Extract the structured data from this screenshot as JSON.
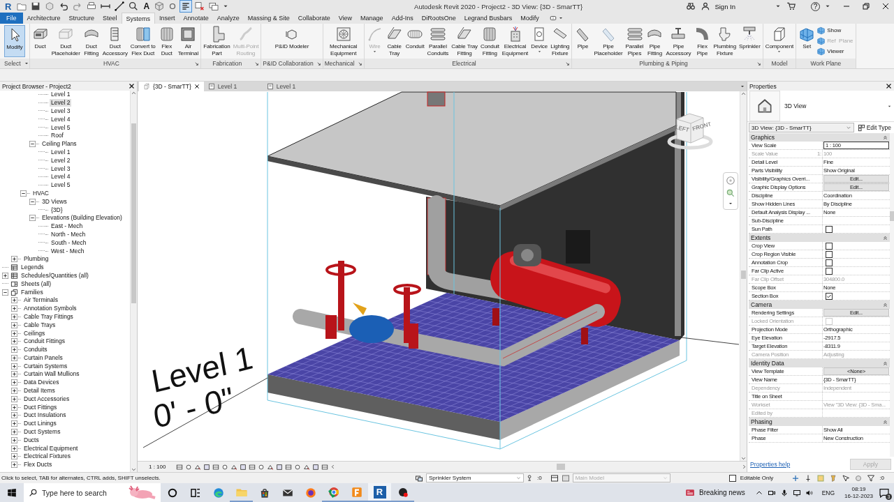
{
  "title_bar": {
    "logo": "R",
    "text_tool": "A",
    "thin_lines_on": true,
    "title": "Autodesk Revit 2020 - Project2 - 3D View: {3D - SmarTT}",
    "sign_in": "Sign In",
    "help": "?"
  },
  "ribbon_tabs": [
    {
      "label": "File",
      "kind": "file",
      "selected": false
    },
    {
      "label": "Architecture",
      "kind": "tab",
      "selected": false
    },
    {
      "label": "Structure",
      "kind": "tab",
      "selected": false
    },
    {
      "label": "Steel",
      "kind": "tab",
      "selected": false
    },
    {
      "label": "Systems",
      "kind": "tab",
      "selected": true
    },
    {
      "label": "Insert",
      "kind": "tab",
      "selected": false
    },
    {
      "label": "Annotate",
      "kind": "tab",
      "selected": false
    },
    {
      "label": "Analyze",
      "kind": "tab",
      "selected": false
    },
    {
      "label": "Massing & Site",
      "kind": "tab",
      "selected": false
    },
    {
      "label": "Collaborate",
      "kind": "tab",
      "selected": false
    },
    {
      "label": "View",
      "kind": "tab",
      "selected": false
    },
    {
      "label": "Manage",
      "kind": "tab",
      "selected": false
    },
    {
      "label": "Add-Ins",
      "kind": "tab",
      "selected": false
    },
    {
      "label": "DiRootsOne",
      "kind": "tab",
      "selected": false
    },
    {
      "label": "Legrand Busbars",
      "kind": "tab",
      "selected": false
    },
    {
      "label": "Modify",
      "kind": "tab",
      "selected": false
    }
  ],
  "ribbon_panels": [
    {
      "title": "Select",
      "kind": "select",
      "launcher": false,
      "tools": [
        {
          "label": "Modify",
          "active": true,
          "disabled": false,
          "menu": false
        }
      ]
    },
    {
      "title": "HVAC",
      "kind": "panel",
      "launcher": true,
      "tools": [
        {
          "label": "Duct",
          "active": false,
          "disabled": false,
          "menu": false
        },
        {
          "label": "Duct\nPlaceholder",
          "active": false,
          "disabled": false,
          "menu": false
        },
        {
          "label": "Duct\nFitting",
          "active": false,
          "disabled": false,
          "menu": false
        },
        {
          "label": "Duct\nAccessory",
          "active": false,
          "disabled": false,
          "menu": false
        },
        {
          "label": "Convert to\nFlex Duct",
          "active": false,
          "disabled": false,
          "menu": false
        },
        {
          "label": "Flex\nDuct",
          "active": false,
          "disabled": false,
          "menu": false
        },
        {
          "label": "Air\nTerminal",
          "active": false,
          "disabled": false,
          "menu": false
        }
      ]
    },
    {
      "title": "Fabrication",
      "kind": "panel",
      "launcher": true,
      "tools": [
        {
          "label": "Fabrication\nPart",
          "active": false,
          "disabled": false,
          "menu": false
        },
        {
          "label": "Multi-Point\nRouting",
          "active": false,
          "disabled": true,
          "menu": false
        }
      ]
    },
    {
      "title": "P&ID Collaboration",
      "kind": "panel",
      "launcher": true,
      "tools": [
        {
          "label": "P&ID Modeler",
          "active": false,
          "disabled": false,
          "menu": false
        }
      ]
    },
    {
      "title": "Mechanical",
      "kind": "panel",
      "launcher": true,
      "tools": [
        {
          "label": "Mechanical\nEquipment",
          "active": false,
          "disabled": false,
          "menu": false
        }
      ]
    },
    {
      "title": "Electrical",
      "kind": "panel",
      "launcher": true,
      "tools": [
        {
          "label": "Wire",
          "active": false,
          "disabled": true,
          "menu": true
        },
        {
          "label": "Cable\nTray",
          "active": false,
          "disabled": false,
          "menu": false
        },
        {
          "label": "Conduit",
          "active": false,
          "disabled": false,
          "menu": false
        },
        {
          "label": "Parallel\nConduits",
          "active": false,
          "disabled": false,
          "menu": false
        },
        {
          "label": "Cable Tray\nFitting",
          "active": false,
          "disabled": false,
          "menu": false
        },
        {
          "label": "Conduit\nFitting",
          "active": false,
          "disabled": false,
          "menu": false
        },
        {
          "label": "Electrical\nEquipment",
          "active": false,
          "disabled": false,
          "menu": false
        },
        {
          "label": "Device",
          "active": false,
          "disabled": false,
          "menu": true
        },
        {
          "label": "Lighting\nFixture",
          "active": false,
          "disabled": false,
          "menu": false
        }
      ]
    },
    {
      "title": "Plumbing & Piping",
      "kind": "panel",
      "launcher": true,
      "tools": [
        {
          "label": "Pipe",
          "active": false,
          "disabled": false,
          "menu": false
        },
        {
          "label": "Pipe\nPlaceholder",
          "active": false,
          "disabled": false,
          "menu": false
        },
        {
          "label": "Parallel\nPipes",
          "active": false,
          "disabled": false,
          "menu": false
        },
        {
          "label": "Pipe\nFitting",
          "active": false,
          "disabled": false,
          "menu": false
        },
        {
          "label": "Pipe\nAccessory",
          "active": false,
          "disabled": false,
          "menu": false
        },
        {
          "label": "Flex\nPipe",
          "active": false,
          "disabled": false,
          "menu": false
        },
        {
          "label": "Plumbing\nFixture",
          "active": false,
          "disabled": false,
          "menu": false
        },
        {
          "label": "Sprinkler",
          "active": false,
          "disabled": false,
          "menu": false
        }
      ]
    },
    {
      "title": "Model",
      "kind": "panel",
      "launcher": false,
      "tools": [
        {
          "label": "Component",
          "active": false,
          "disabled": false,
          "menu": true
        }
      ]
    },
    {
      "title": "Work Plane",
      "kind": "panel",
      "launcher": false,
      "tools": [
        {
          "label": "Set",
          "active": false,
          "disabled": false,
          "menu": false
        }
      ],
      "small_tools": [
        {
          "label": "Show",
          "disabled": false
        },
        {
          "label": "Ref  Plane",
          "disabled": true
        },
        {
          "label": "Viewer",
          "disabled": false
        }
      ]
    }
  ],
  "project_browser": {
    "title": "Project Browser - Project2",
    "tree": [
      {
        "children": [
          {
            "children": [
              {
                "children": [
                  {
                    "children": [
                      {
                        "label": "Level 1",
                        "selected": false
                      },
                      {
                        "label": "Level 2",
                        "selected": true
                      },
                      {
                        "label": "Level 3",
                        "selected": false
                      },
                      {
                        "label": "Level 4",
                        "selected": false
                      },
                      {
                        "label": "Level 5",
                        "selected": false
                      },
                      {
                        "label": "Roof",
                        "selected": false
                      }
                    ]
                  },
                  {
                    "label": "Ceiling Plans",
                    "expanded": true,
                    "selected": false,
                    "children": [
                      {
                        "label": "Level 1",
                        "selected": false
                      },
                      {
                        "label": "Level 2",
                        "selected": false
                      },
                      {
                        "label": "Level 3",
                        "selected": false
                      },
                      {
                        "label": "Level 4",
                        "selected": false
                      },
                      {
                        "label": "Level 5",
                        "selected": false
                      }
                    ]
                  }
                ]
              },
              {
                "label": "HVAC",
                "expanded": true,
                "selected": false,
                "children": [
                  {
                    "label": "3D Views",
                    "expanded": true,
                    "selected": false,
                    "children": [
                      {
                        "label": "{3D}",
                        "selected": false
                      }
                    ]
                  },
                  {
                    "label": "Elevations (Building Elevation)",
                    "expanded": true,
                    "selected": false,
                    "children": [
                      {
                        "label": "East - Mech",
                        "selected": false
                      },
                      {
                        "label": "North - Mech",
                        "selected": false
                      },
                      {
                        "label": "South - Mech",
                        "selected": false
                      },
                      {
                        "label": "West - Mech",
                        "selected": false
                      }
                    ]
                  }
                ]
              }
            ]
          },
          {
            "label": "Plumbing",
            "expanded": false,
            "selected": false
          }
        ]
      },
      {
        "label": "Legends",
        "kind": "legends",
        "selected": false
      },
      {
        "label": "Schedules/Quantities (all)",
        "kind": "schedules",
        "expanded": false,
        "selected": false
      },
      {
        "label": "Sheets (all)",
        "kind": "sheets",
        "selected": false
      },
      {
        "label": "Families",
        "kind": "families",
        "expanded": true,
        "selected": false,
        "children": [
          {
            "label": "Air Terminals",
            "expanded": false,
            "selected": false
          },
          {
            "label": "Annotation Symbols",
            "expanded": false,
            "selected": false
          },
          {
            "label": "Cable Tray Fittings",
            "expanded": false,
            "selected": false
          },
          {
            "label": "Cable Trays",
            "expanded": false,
            "selected": false
          },
          {
            "label": "Ceilings",
            "expanded": false,
            "selected": false
          },
          {
            "label": "Conduit Fittings",
            "expanded": false,
            "selected": false
          },
          {
            "label": "Conduits",
            "expanded": false,
            "selected": false
          },
          {
            "label": "Curtain Panels",
            "expanded": false,
            "selected": false
          },
          {
            "label": "Curtain Systems",
            "expanded": false,
            "selected": false
          },
          {
            "label": "Curtain Wall Mullions",
            "expanded": false,
            "selected": false
          },
          {
            "label": "Data Devices",
            "expanded": false,
            "selected": false
          },
          {
            "label": "Detail Items",
            "expanded": false,
            "selected": false
          },
          {
            "label": "Duct Accessories",
            "expanded": false,
            "selected": false
          },
          {
            "label": "Duct Fittings",
            "expanded": false,
            "selected": false
          },
          {
            "label": "Duct Insulations",
            "expanded": false,
            "selected": false
          },
          {
            "label": "Duct Linings",
            "expanded": false,
            "selected": false
          },
          {
            "label": "Duct Systems",
            "expanded": false,
            "selected": false
          },
          {
            "label": "Ducts",
            "expanded": false,
            "selected": false
          },
          {
            "label": "Electrical Equipment",
            "expanded": false,
            "selected": false
          },
          {
            "label": "Electrical Fixtures",
            "expanded": false,
            "selected": false
          },
          {
            "label": "Flex Ducts",
            "expanded": false,
            "selected": false
          }
        ]
      }
    ]
  },
  "viewport": {
    "tabs": [
      {
        "label": "{3D - SmarTT}",
        "kind": "model",
        "selected": true,
        "closable": true
      },
      {
        "label": "Level 1",
        "kind": "plan",
        "selected": false,
        "closable": false
      },
      {
        "label": "Level 1",
        "kind": "plan",
        "selected": false,
        "closable": false
      }
    ],
    "level_tag": {
      "name": "Level 1",
      "elevation": "0' - 0\""
    },
    "view_cube": {
      "faces": [
        "LEFT",
        "FRONT"
      ]
    },
    "scale": "1 : 100"
  },
  "properties": {
    "title": "Properties",
    "type_name": "3D View",
    "instance": "3D View: {3D - SmarTT}",
    "edit_type": "Edit Type",
    "groups": [
      {
        "name": "Graphics",
        "expanded": true,
        "rows": [
          {
            "label": "View Scale",
            "kind": "field",
            "value": "1 : 100",
            "disabled": false
          },
          {
            "label": "Scale Value",
            "suffix": "1:",
            "kind": "text",
            "value": "100",
            "disabled": true
          },
          {
            "label": "Detail Level",
            "kind": "text",
            "value": "Fine",
            "disabled": false
          },
          {
            "label": "Parts Visibility",
            "kind": "text",
            "value": "Show Original",
            "disabled": false
          },
          {
            "label": "Visibility/Graphics Overri...",
            "kind": "button",
            "value": "Edit...",
            "disabled": false
          },
          {
            "label": "Graphic Display Options",
            "kind": "button",
            "value": "Edit...",
            "disabled": false
          },
          {
            "label": "Discipline",
            "kind": "text",
            "value": "Coordination",
            "disabled": false
          },
          {
            "label": "Show Hidden Lines",
            "kind": "text",
            "value": "By Discipline",
            "disabled": false
          },
          {
            "label": "Default Analysis Display ...",
            "kind": "text",
            "value": "None",
            "disabled": false
          },
          {
            "label": "Sub-Discipline",
            "kind": "empty",
            "disabled": false
          },
          {
            "label": "Sun Path",
            "kind": "checkbox",
            "checked": false,
            "disabled": false
          }
        ]
      },
      {
        "name": "Extents",
        "expanded": true,
        "rows": [
          {
            "label": "Crop View",
            "kind": "checkbox",
            "checked": false,
            "disabled": false
          },
          {
            "label": "Crop Region Visible",
            "kind": "checkbox",
            "checked": false,
            "disabled": false
          },
          {
            "label": "Annotation Crop",
            "kind": "checkbox",
            "checked": false,
            "disabled": false
          },
          {
            "label": "Far Clip Active",
            "kind": "checkbox",
            "checked": false,
            "disabled": false
          },
          {
            "label": "Far Clip Offset",
            "kind": "text",
            "value": "304800.0",
            "disabled": true
          },
          {
            "label": "Scope Box",
            "kind": "text",
            "value": "None",
            "disabled": false
          },
          {
            "label": "Section Box",
            "kind": "checkbox",
            "checked": true,
            "disabled": false
          }
        ]
      },
      {
        "name": "Camera",
        "expanded": true,
        "rows": [
          {
            "label": "Rendering Settings",
            "kind": "button",
            "value": "Edit...",
            "disabled": false
          },
          {
            "label": "Locked Orientation",
            "kind": "checkbox",
            "checked": false,
            "disabled": true
          },
          {
            "label": "Projection Mode",
            "kind": "text",
            "value": "Orthographic",
            "disabled": false
          },
          {
            "label": "Eye Elevation",
            "kind": "text",
            "value": "-2917.5",
            "disabled": false
          },
          {
            "label": "Target Elevation",
            "kind": "text",
            "value": "-8311.9",
            "disabled": false
          },
          {
            "label": "Camera Position",
            "kind": "text",
            "value": "Adjusting",
            "disabled": true
          }
        ]
      },
      {
        "name": "Identity Data",
        "expanded": true,
        "rows": [
          {
            "label": "View Template",
            "kind": "button",
            "value": "<None>",
            "disabled": false
          },
          {
            "label": "View Name",
            "kind": "text",
            "value": "{3D - SmarTT}",
            "disabled": false
          },
          {
            "label": "Dependency",
            "kind": "text",
            "value": "Independent",
            "disabled": true
          },
          {
            "label": "Title on Sheet",
            "kind": "empty",
            "disabled": false
          },
          {
            "label": "Workset",
            "kind": "text",
            "value": "View \"3D View: {3D - Sma...",
            "disabled": true
          },
          {
            "label": "Edited by",
            "kind": "empty",
            "disabled": true
          }
        ]
      },
      {
        "name": "Phasing",
        "expanded": true,
        "rows": [
          {
            "label": "Phase Filter",
            "kind": "text",
            "value": "Show All",
            "disabled": false
          },
          {
            "label": "Phase",
            "kind": "text",
            "value": "New Construction",
            "disabled": false
          }
        ]
      }
    ],
    "help": "Properties help",
    "apply": "Apply",
    "apply_disabled": true
  },
  "status_bar": {
    "hint": "Click to select, TAB for alternates, CTRL adds, SHIFT unselects.",
    "workset": "Sprinkler System",
    "workset_count": ":0",
    "design_option": "Main Model",
    "editable_only": false,
    "editable_label": "Editable Only",
    "filter_count": ":0"
  },
  "taskbar": {
    "search_placeholder": "Type here to search",
    "apps": [
      {
        "running": false,
        "selected": false
      },
      {
        "running": false,
        "selected": false
      },
      {
        "running": false,
        "selected": false
      },
      {
        "running": true,
        "selected": false
      },
      {
        "running": false,
        "selected": false
      },
      {
        "running": false,
        "selected": false
      },
      {
        "running": false,
        "selected": false
      },
      {
        "running": true,
        "selected": false
      },
      {
        "running": true,
        "selected": false
      },
      {
        "running": true,
        "selected": true,
        "label": "R"
      },
      {
        "running": true,
        "selected": false
      }
    ],
    "news": "Breaking news",
    "language": "ENG",
    "time": "08:19",
    "date": "16-12-2023",
    "notifications": "3"
  }
}
